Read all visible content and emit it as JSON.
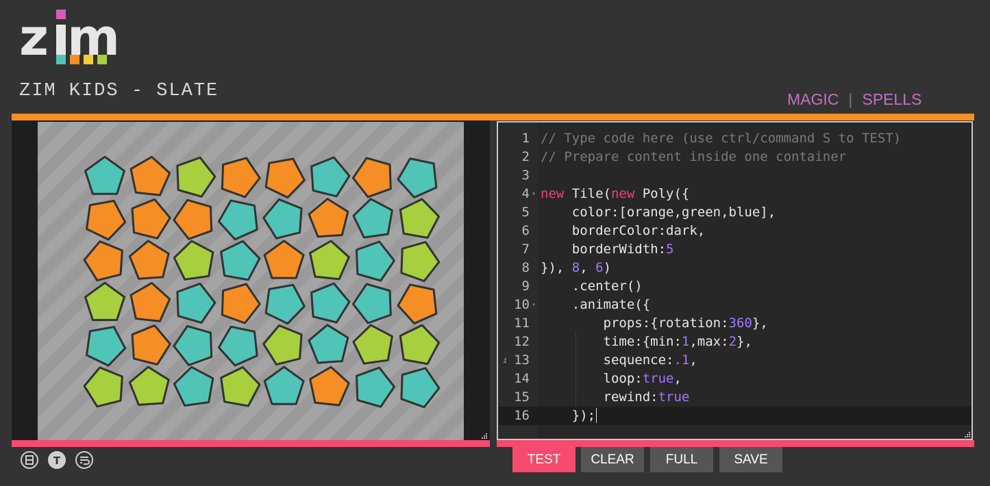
{
  "app": {
    "logo_text": "zim",
    "subtitle": "ZIM KIDS - SLATE"
  },
  "nav": {
    "magic": "MAGIC",
    "separator": "|",
    "spells": "SPELLS"
  },
  "colors": {
    "orange": "#f58e25",
    "green": "#a7cf3e",
    "blue": "#50c4b7",
    "dark": "#333333",
    "pink": "#f74a6e",
    "magenta": "#c66fc6"
  },
  "stage": {
    "grid": [
      [
        "blue",
        "orange",
        "green",
        "orange",
        "orange",
        "blue",
        "orange",
        "blue"
      ],
      [
        "orange",
        "orange",
        "orange",
        "blue",
        "blue",
        "orange",
        "blue",
        "green"
      ],
      [
        "orange",
        "orange",
        "green",
        "blue",
        "orange",
        "green",
        "blue",
        "green"
      ],
      [
        "green",
        "orange",
        "blue",
        "orange",
        "blue",
        "blue",
        "blue",
        "orange"
      ],
      [
        "blue",
        "orange",
        "blue",
        "blue",
        "green",
        "blue",
        "green",
        "green"
      ],
      [
        "green",
        "green",
        "blue",
        "green",
        "blue",
        "orange",
        "blue",
        "blue"
      ]
    ]
  },
  "editor": {
    "lines": [
      {
        "num": "1",
        "tokens": [
          [
            "com",
            "// Type code here (use ctrl/command S to TEST)"
          ]
        ]
      },
      {
        "num": "2",
        "tokens": [
          [
            "com",
            "// Prepare content inside one container"
          ]
        ]
      },
      {
        "num": "3",
        "tokens": []
      },
      {
        "num": "4",
        "fold": true,
        "tokens": [
          [
            "kw",
            "new"
          ],
          [
            "",
            " Tile("
          ],
          [
            "kw",
            "new"
          ],
          [
            "",
            " Poly({"
          ]
        ]
      },
      {
        "num": "5",
        "tokens": [
          [
            "",
            "    color:[orange,green,blue],"
          ]
        ]
      },
      {
        "num": "6",
        "tokens": [
          [
            "",
            "    borderColor:dark,"
          ]
        ]
      },
      {
        "num": "7",
        "tokens": [
          [
            "",
            "    borderWidth:"
          ],
          [
            "num",
            "5"
          ]
        ]
      },
      {
        "num": "8",
        "tokens": [
          [
            "",
            "}), "
          ],
          [
            "num",
            "8"
          ],
          [
            "",
            ", "
          ],
          [
            "num",
            "6"
          ],
          [
            "",
            ")"
          ]
        ]
      },
      {
        "num": "9",
        "tokens": [
          [
            "",
            "    .center()"
          ]
        ]
      },
      {
        "num": "10",
        "fold": true,
        "tokens": [
          [
            "",
            "    .animate({"
          ]
        ]
      },
      {
        "num": "11",
        "tokens": [
          [
            "",
            "        props:{rotation:"
          ],
          [
            "num",
            "360"
          ],
          [
            "",
            "},"
          ]
        ]
      },
      {
        "num": "12",
        "tokens": [
          [
            "",
            "        time:{min:"
          ],
          [
            "num",
            "1"
          ],
          [
            "",
            ",max:"
          ],
          [
            "num",
            "2"
          ],
          [
            "",
            "},"
          ]
        ]
      },
      {
        "num": "13",
        "info": true,
        "tokens": [
          [
            "",
            "        sequence:"
          ],
          [
            "num",
            ".1"
          ],
          [
            "",
            ","
          ]
        ]
      },
      {
        "num": "14",
        "tokens": [
          [
            "",
            "        loop:"
          ],
          [
            "bool",
            "true"
          ],
          [
            "",
            ","
          ]
        ]
      },
      {
        "num": "15",
        "tokens": [
          [
            "",
            "        rewind:"
          ],
          [
            "bool",
            "true"
          ]
        ]
      },
      {
        "num": "16",
        "active": true,
        "tokens": [
          [
            "",
            "    });"
          ]
        ]
      }
    ]
  },
  "tools": [
    "split-view-icon",
    "text-toggle-icon",
    "wrap-icon"
  ],
  "buttons": {
    "test": "TEST",
    "clear": "CLEAR",
    "full": "FULL",
    "save": "SAVE"
  }
}
